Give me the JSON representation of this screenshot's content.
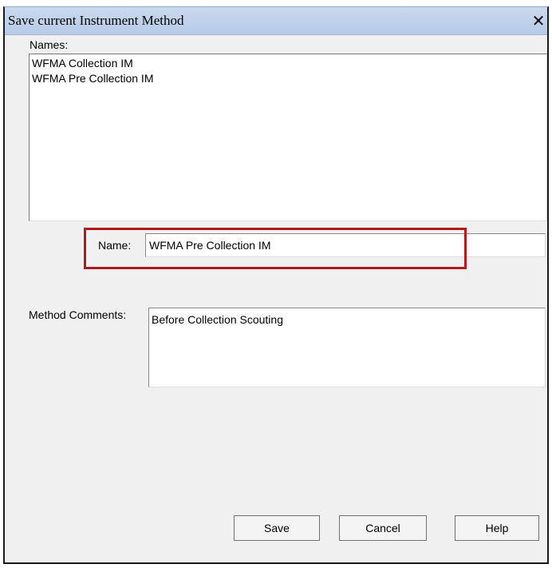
{
  "window": {
    "title": "Save current Instrument Method",
    "close_glyph": "✕"
  },
  "names": {
    "label": "Names:",
    "items": [
      "WFMA Collection IM",
      "WFMA Pre Collection IM"
    ]
  },
  "name_field": {
    "label": "Name:",
    "value": "WFMA Pre Collection IM"
  },
  "comments": {
    "label": "Method Comments:",
    "value": "Before Collection Scouting"
  },
  "buttons": {
    "save": "Save",
    "cancel": "Cancel",
    "help": "Help"
  },
  "colors": {
    "titlebar": "#c2d4ed",
    "highlight": "#b01a1a",
    "dialog_bg": "#f0f0f0"
  },
  "icons": {
    "close": "close-icon"
  }
}
